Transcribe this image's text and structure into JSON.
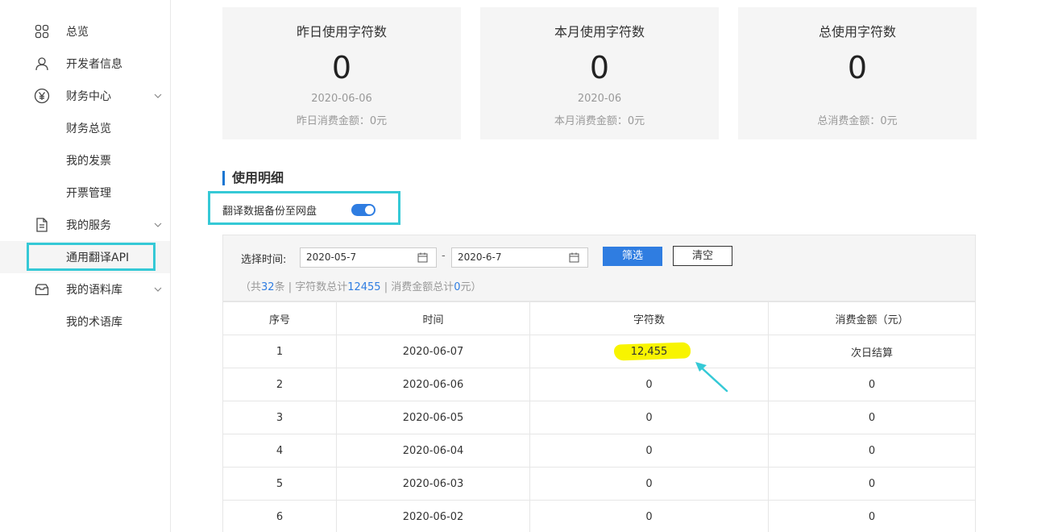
{
  "sidebar": {
    "items": [
      {
        "label": "总览",
        "icon": "grid-icon"
      },
      {
        "label": "开发者信息",
        "icon": "user-icon"
      },
      {
        "label": "财务中心",
        "icon": "yen-icon"
      },
      {
        "label": "财务总览"
      },
      {
        "label": "我的发票"
      },
      {
        "label": "开票管理"
      },
      {
        "label": "我的服务",
        "icon": "document-icon"
      },
      {
        "label": "通用翻译API",
        "active": true
      },
      {
        "label": "我的语料库",
        "icon": "inbox-icon"
      },
      {
        "label": "我的术语库"
      }
    ]
  },
  "cards": [
    {
      "title": "昨日使用字符数",
      "value": "0",
      "date": "2020-06-06",
      "amount": "昨日消费金额：0元"
    },
    {
      "title": "本月使用字符数",
      "value": "0",
      "date": "2020-06",
      "amount": "本月消费金额：0元"
    },
    {
      "title": "总使用字符数",
      "value": "0",
      "date": "",
      "amount": "总消费金额：0元"
    }
  ],
  "section_title": "使用明细",
  "backup": {
    "label": "翻译数据备份至网盘",
    "enabled": true
  },
  "filter": {
    "label": "选择时间:",
    "start": "2020-05-7",
    "end": "2020-6-7",
    "filter_btn": "筛选",
    "clear_btn": "清空"
  },
  "summary": {
    "p1": "（共",
    "count": "32",
    "p2": "条 | 字符数总计",
    "chars": "12455",
    "p3": " | 消费金额总计",
    "amount": "0",
    "p4": "元）"
  },
  "table": {
    "headers": [
      "序号",
      "时间",
      "字符数",
      "消费金额（元）"
    ],
    "rows": [
      [
        "1",
        "2020-06-07",
        "12,455",
        "次日结算"
      ],
      [
        "2",
        "2020-06-06",
        "0",
        "0"
      ],
      [
        "3",
        "2020-06-05",
        "0",
        "0"
      ],
      [
        "4",
        "2020-06-04",
        "0",
        "0"
      ],
      [
        "5",
        "2020-06-03",
        "0",
        "0"
      ],
      [
        "6",
        "2020-06-02",
        "0",
        "0"
      ]
    ]
  },
  "colors": {
    "accent": "#2f7de1",
    "highlight_box": "#35c9d6",
    "marker": "#f8f400"
  }
}
